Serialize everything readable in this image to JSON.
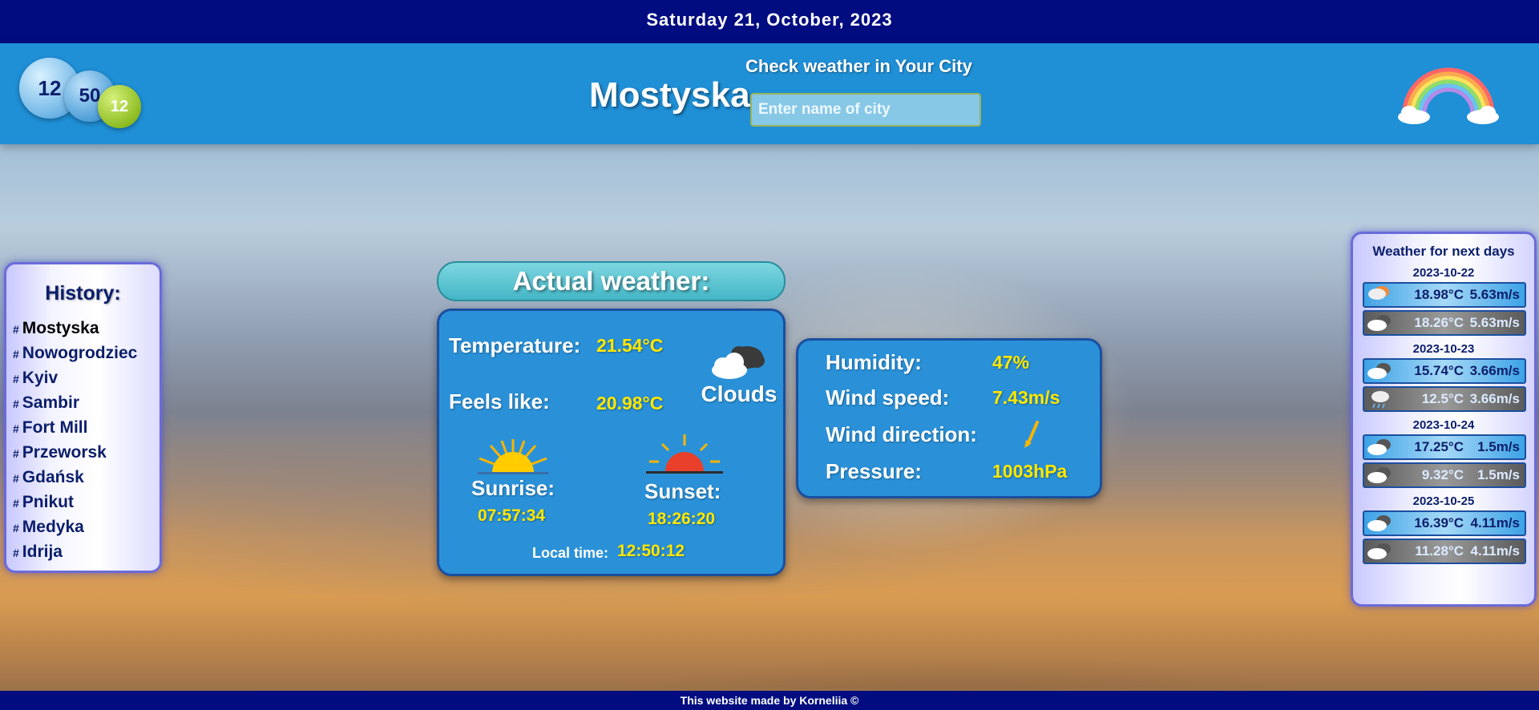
{
  "date_bar": "Saturday 21, October, 2023",
  "clock": {
    "hours": "12",
    "minutes": "50",
    "seconds": "12"
  },
  "header": {
    "city": "Mostyska",
    "search_label": "Check weather in Your City",
    "search_placeholder": "Enter name of city",
    "rainbow_icon": "rainbow-icon"
  },
  "history": {
    "title": "History:",
    "items": [
      "Mostyska",
      "Nowogrodziec",
      "Kyiv",
      "Sambir",
      "Fort Mill",
      "Przeworsk",
      "Gdańsk",
      "Pnikut",
      "Medyka",
      "Idrija"
    ]
  },
  "actual": {
    "title": "Actual weather:",
    "temperature_label": "Temperature:",
    "temperature": "21.54°C",
    "feels_like_label": "Feels like:",
    "feels_like": "20.98°C",
    "description": "Clouds",
    "sunrise_label": "Sunrise:",
    "sunrise": "07:57:34",
    "sunset_label": "Sunset:",
    "sunset": "18:26:20",
    "local_time_label": "Local time:",
    "local_time": "12:50:12"
  },
  "details": {
    "humidity_label": "Humidity:",
    "humidity": "47%",
    "wind_speed_label": "Wind speed:",
    "wind_speed": "7.43m/s",
    "wind_direction_label": "Wind direction:",
    "pressure_label": "Pressure:",
    "pressure": "1003hPa"
  },
  "forecast": {
    "title": "Weather for next days",
    "days": [
      {
        "date": "2023-10-22",
        "day": {
          "icon": "rain-cloud-icon",
          "temp": "18.98°C",
          "wind": "5.63m/s"
        },
        "night": {
          "icon": "cloud-icon",
          "temp": "18.26°C",
          "wind": "5.63m/s"
        }
      },
      {
        "date": "2023-10-23",
        "day": {
          "icon": "cloud-icon",
          "temp": "15.74°C",
          "wind": "3.66m/s"
        },
        "night": {
          "icon": "rain-cloud-icon",
          "temp": "12.5°C",
          "wind": "3.66m/s"
        }
      },
      {
        "date": "2023-10-24",
        "day": {
          "icon": "cloud-icon",
          "temp": "17.25°C",
          "wind": "1.5m/s"
        },
        "night": {
          "icon": "cloud-icon",
          "temp": "9.32°C",
          "wind": "1.5m/s"
        }
      },
      {
        "date": "2023-10-25",
        "day": {
          "icon": "cloud-icon",
          "temp": "16.39°C",
          "wind": "4.11m/s"
        },
        "night": {
          "icon": "cloud-icon",
          "temp": "11.28°C",
          "wind": "4.11m/s"
        }
      }
    ]
  },
  "footer": "This website made by Korneliia ©",
  "colors": {
    "top_bar": "#000c80",
    "header": "#1f8fd6",
    "panel": "#2a91d8",
    "value_yellow": "#ffe800"
  }
}
